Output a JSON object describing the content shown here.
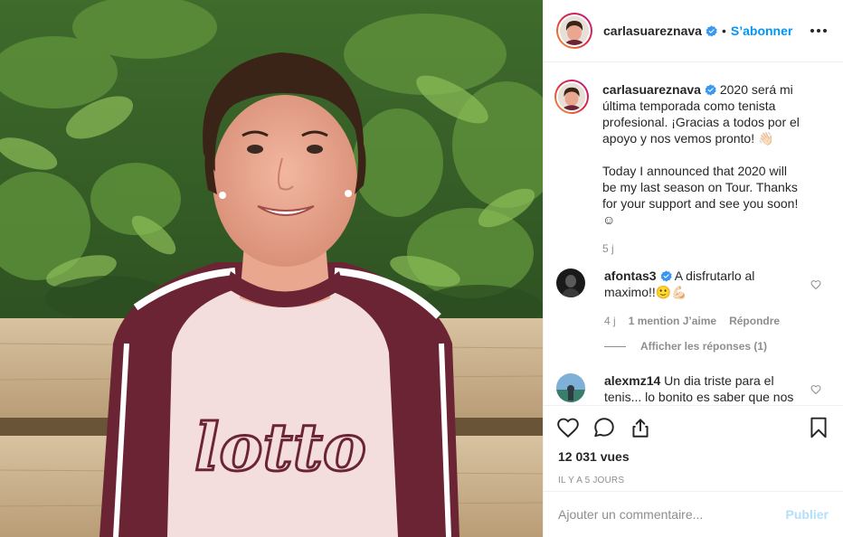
{
  "post": {
    "username": "carlasuareznava",
    "follow_label": "S’abonner",
    "separator": "•",
    "caption_p1": "2020 será mi última temporada como tenista profesional. ¡Gracias a todos por el apoyo y nos vemos pronto! 👋🏻",
    "caption_p2": "Today I announced that 2020 will be my last season on Tour. Thanks for your support and see you soon! ☺",
    "caption_age": "5 j",
    "views": "12 031 vues",
    "date": "IL Y A 5 JOURS",
    "sweater_logo": "lotto"
  },
  "comments": [
    {
      "username": "afontas3",
      "text": "A disfrutarlo al maximo!!🙂💪🏻",
      "age": "4 j",
      "likes": "1 mention J’aime",
      "reply_label": "Répondre",
      "view_replies": "Afficher les réponses (1)"
    },
    {
      "username": "alexmz14",
      "text": "Un dia triste para el tenis... lo bonito es saber que nos has hecho disfrutar cada minuto"
    }
  ],
  "add_comment": {
    "placeholder": "Ajouter un commentaire...",
    "publish_label": "Publier"
  },
  "icons": {
    "verified": "verified-badge-icon",
    "more": "more-options-icon",
    "like": "heart-icon",
    "comment": "comment-icon",
    "share": "share-icon",
    "save": "bookmark-icon"
  },
  "colors": {
    "accent": "#0095f6",
    "publish_disabled": "#b2dffc",
    "muted": "#8e8e8e",
    "text": "#262626",
    "border": "#efefef"
  }
}
